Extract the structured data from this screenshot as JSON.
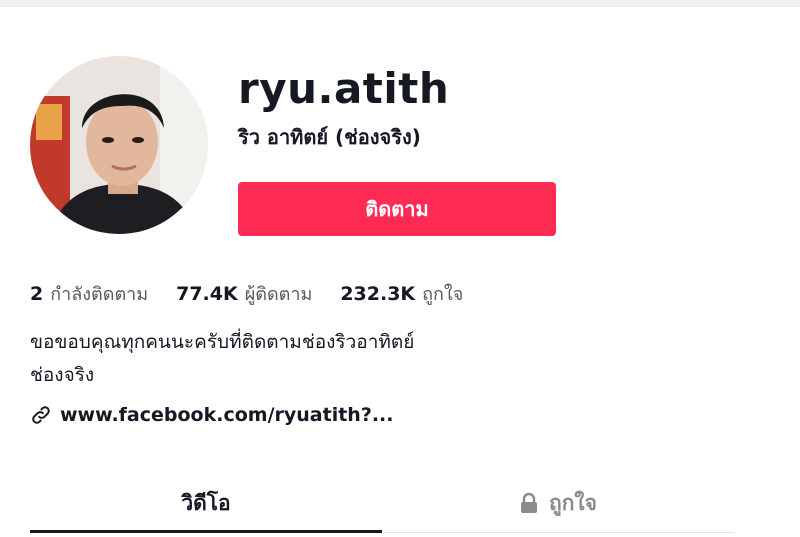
{
  "profile": {
    "username": "ryu.atith",
    "nickname": "ริว อาทิตย์ (ช่องจริง)",
    "follow_label": "ติดตาม",
    "avatar_icon": "profile-photo"
  },
  "stats": [
    {
      "value": "2",
      "label": "กำลังติดตาม"
    },
    {
      "value": "77.4K",
      "label": "ผู้ติดตาม"
    },
    {
      "value": "232.3K",
      "label": "ถูกใจ"
    }
  ],
  "bio": {
    "line1": "ขอขอบคุณทุกคนนะครับที่ติดตามช่องริวอาทิตย์",
    "line2": "ช่องจริง"
  },
  "link": {
    "icon": "link-icon",
    "text": "www.facebook.com/ryuatith?..."
  },
  "tabs": [
    {
      "label": "วิดีโอ",
      "active": true
    },
    {
      "label": "ถูกใจ",
      "active": false,
      "icon": "lock-icon"
    }
  ],
  "colors": {
    "accent": "#fe2c55",
    "text": "#161823",
    "muted": "#8a8b91"
  }
}
